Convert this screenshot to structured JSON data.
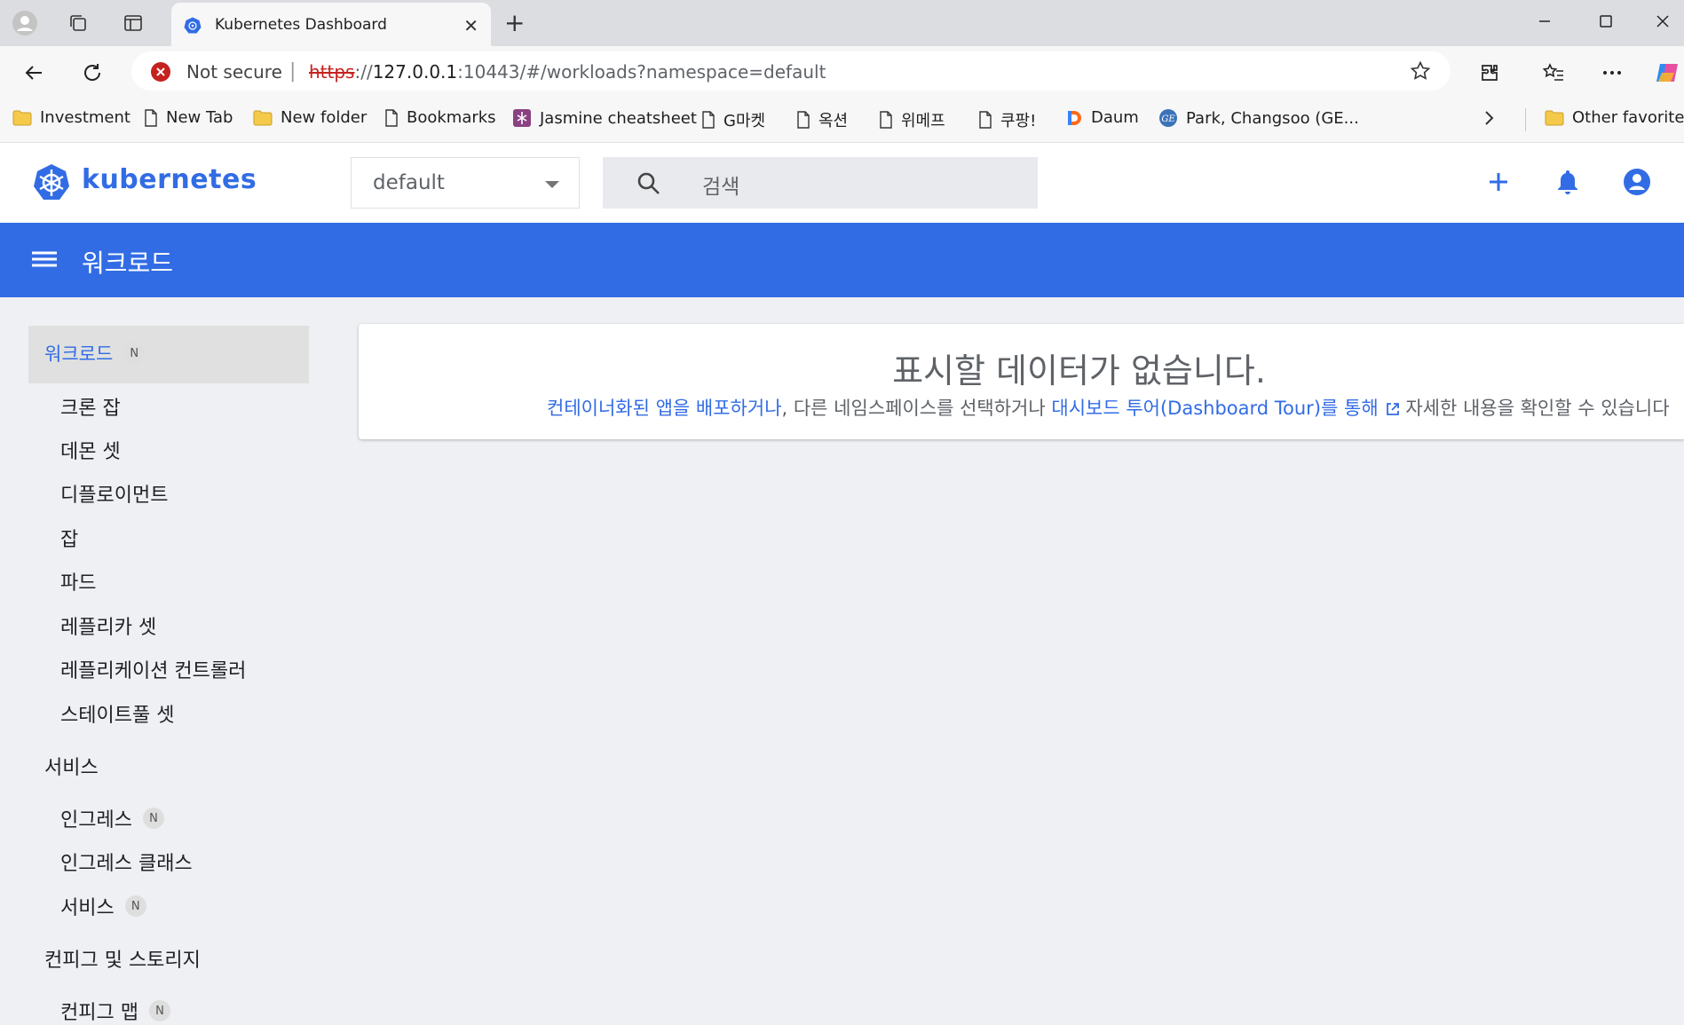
{
  "browser": {
    "tab_title": "Kubernetes Dashboard",
    "url": {
      "scheme": "https",
      "rest_pre": "://",
      "host": "127.0.0.1",
      "rest": ":10443/#/workloads?namespace=default"
    },
    "security_label": "Not secure",
    "bookmarks": [
      {
        "label": "Investment",
        "icon": "folder-icon"
      },
      {
        "label": "New Tab",
        "icon": "page-icon"
      },
      {
        "label": "New folder",
        "icon": "folder-icon"
      },
      {
        "label": "Bookmarks",
        "icon": "page-icon"
      },
      {
        "label": "Jasmine cheatsheet",
        "icon": "jasmine-icon"
      },
      {
        "label": "G마켓",
        "icon": "page-icon"
      },
      {
        "label": "옥션",
        "icon": "page-icon"
      },
      {
        "label": "위메프",
        "icon": "page-icon"
      },
      {
        "label": "쿠팡!",
        "icon": "page-icon"
      },
      {
        "label": "Daum",
        "icon": "daum-icon"
      },
      {
        "label": "Park, Changsoo (GE...",
        "icon": "ge-icon"
      }
    ],
    "other_favorites": "Other favorites"
  },
  "header": {
    "brand": "kubernetes",
    "namespace": "default",
    "search_placeholder": "검색"
  },
  "titlebar": {
    "title": "워크로드"
  },
  "sidebar": {
    "active": {
      "label": "워크로드",
      "badge": "N"
    },
    "workloads": [
      "크론 잡",
      "데몬 셋",
      "디플로이먼트",
      "잡",
      "파드",
      "레플리카 셋",
      "레플리케이션 컨트롤러",
      "스테이트풀 셋"
    ],
    "service_section": "서비스",
    "service_items": [
      {
        "label": "인그레스",
        "badge": "N"
      },
      {
        "label": "인그레스 클래스",
        "badge": ""
      },
      {
        "label": "서비스",
        "badge": "N"
      }
    ],
    "config_section": "컨피그 및 스토리지",
    "config_items": [
      {
        "label": "컨피그 맵",
        "badge": "N"
      }
    ]
  },
  "main": {
    "empty_title": "표시할 데이터가 없습니다.",
    "empty_link1": "컨테이너화된 앱을 배포하거나",
    "empty_text1": ", 다른 네임스페이스를 선택하거나 ",
    "empty_link2": "대시보드 투어(Dashboard Tour)를 통해",
    "empty_text2": " 자세한 내용을 확인할 수 있습니다"
  },
  "colors": {
    "accent": "#326ce5",
    "error": "#c5221f"
  }
}
